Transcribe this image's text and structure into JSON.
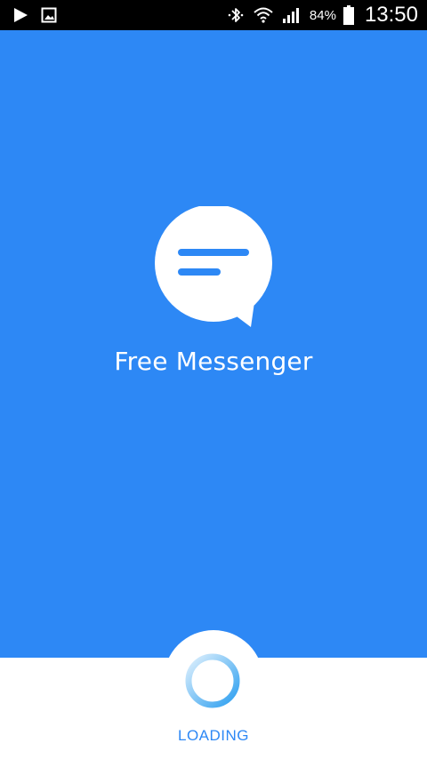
{
  "status_bar": {
    "left_icons": [
      "play-icon",
      "image-icon"
    ],
    "right_icons": [
      "bluetooth-icon",
      "wifi-icon",
      "signal-icon",
      "battery-icon"
    ],
    "battery_percent": "84%",
    "time": "13:50"
  },
  "splash": {
    "app_name": "Free Messenger",
    "background_color": "#2d88f5",
    "logo_icon": "chat-bubble-icon"
  },
  "loading": {
    "label": "LOADING",
    "accent_color": "#2d88f5",
    "spinner_icon": "loading-spinner-icon"
  }
}
